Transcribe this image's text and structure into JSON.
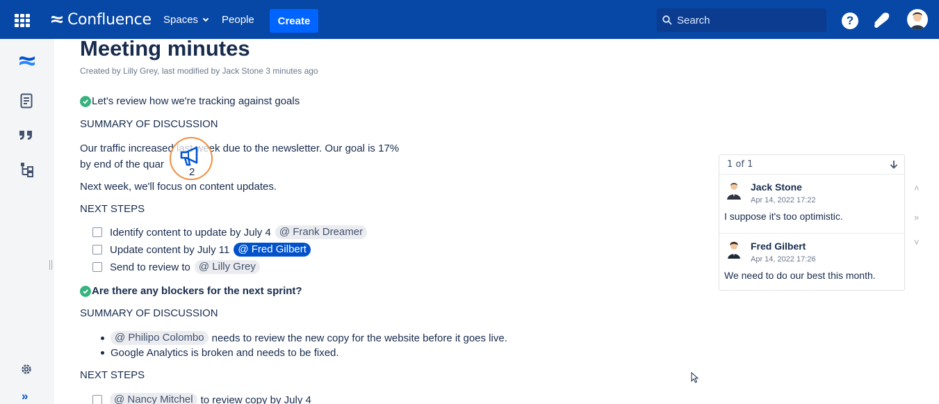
{
  "app": {
    "name": "Confluence"
  },
  "nav": {
    "spaces": "Spaces",
    "people": "People",
    "create": "Create",
    "search_placeholder": "Search",
    "help": "?"
  },
  "colors": {
    "topbar": "#0747a6",
    "create": "#0065ff",
    "success": "#36b37e",
    "mention_self": "#0052cc",
    "badge_ring": "#f08d3c"
  },
  "sidebar": {
    "items": [
      {
        "icon": "confluence-logo-icon"
      },
      {
        "icon": "page-icon"
      },
      {
        "icon": "quote-icon"
      },
      {
        "icon": "page-tree-icon"
      }
    ],
    "bottom": [
      {
        "icon": "gear-icon"
      },
      {
        "icon": "expand-double-chevron-icon",
        "label": "»"
      }
    ]
  },
  "page": {
    "title": "Meeting minutes",
    "byline": "Created by Lilly Grey, last modified by Jack Stone 3 minutes ago",
    "section1": {
      "heading": "Let's review how we're tracking against goals",
      "summary_label": "SUMMARY OF DISCUSSION",
      "p1_line1": "Our traffic increased     last week due to the newsletter. Our goal is 17%",
      "p1_line2": "by end of the quar",
      "p2": "Next week, we'll focus on content updates.",
      "next_label": "NEXT STEPS",
      "tasks": [
        {
          "text": "Identify content to update by July 4",
          "mention": "@ Frank Dreamer"
        },
        {
          "text": "Update content by July 11",
          "mention": "@ Fred Gilbert"
        },
        {
          "text": "Send to review to",
          "mention": "@ Lilly Grey"
        }
      ]
    },
    "section2": {
      "heading": "Are there any blockers for the next sprint?",
      "summary_label": "SUMMARY OF DISCUSSION",
      "bullets": [
        {
          "mention": "@ Philipo Colombo",
          "text": "needs to review the new copy for the website before it goes live."
        },
        {
          "text": "Google Analytics is broken and needs to be fixed."
        }
      ],
      "next_label": "NEXT STEPS",
      "tasks": [
        {
          "mention": "@ Nancy Mitchel",
          "text": "to review copy by July 4"
        }
      ]
    }
  },
  "badge": {
    "icon": "megaphone-icon",
    "count": "2"
  },
  "comments": {
    "pager": "1 of 1",
    "items": [
      {
        "author": "Jack Stone",
        "date": "Apr 14, 2022 17:22",
        "text": "I suppose it's too optimistic."
      },
      {
        "author": "Fred Gilbert",
        "date": "Apr 14, 2022 17:26",
        "text": "We need to do our best this month."
      }
    ],
    "side_arrows": {
      "up": "˄",
      "right": "»",
      "down": "˅"
    }
  }
}
